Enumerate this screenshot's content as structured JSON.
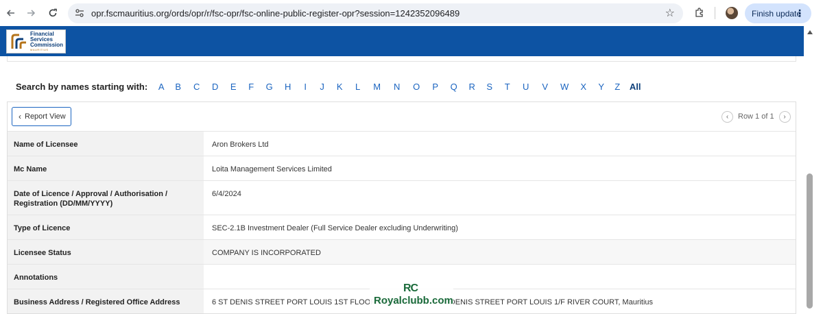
{
  "browser": {
    "url": "opr.fscmauritius.org/ords/opr/r/fsc-opr/fsc-online-public-register-opr?session=1242352096489",
    "finish_update_label": "Finish update"
  },
  "header": {
    "logo_lines": [
      "Financial",
      "Services",
      "Commission"
    ],
    "logo_sub": "MAURITIUS"
  },
  "alpha_filter": {
    "label": "Search by names starting with:",
    "letters": [
      "A",
      "B",
      "C",
      "D",
      "E",
      "F",
      "G",
      "H",
      "I",
      "J",
      "K",
      "L",
      "M",
      "N",
      "O",
      "P",
      "Q",
      "R",
      "S",
      "T",
      "U",
      "V",
      "W",
      "X",
      "Y",
      "Z"
    ],
    "all_label": "All"
  },
  "report": {
    "back_label": "Report View",
    "pager_text": "Row 1 of 1",
    "rows": [
      {
        "label": "Name of Licensee",
        "value": "Aron Brokers Ltd"
      },
      {
        "label": "Mc Name",
        "value": "Loita Management Services Limited"
      },
      {
        "label": "Date of Licence / Approval / Authorisation / Registration (DD/MM/YYYY)",
        "value": "6/4/2024"
      },
      {
        "label": "Type of Licence",
        "value": "SEC-2.1B Investment Dealer (Full Service Dealer excluding Underwriting)"
      },
      {
        "label": "Licensee Status",
        "value": "COMPANY IS INCORPORATED"
      },
      {
        "label": "Annotations",
        "value": ""
      },
      {
        "label": "Business Address / Registered Office Address",
        "value": "6 ST DENIS STREET PORT LOUIS 1ST FLOOR RIVER COURT 6 ST DENIS STREET PORT LOUIS 1/F RIVER COURT, Mauritius"
      }
    ]
  },
  "watermark": {
    "mark": "RC",
    "text": "Royalclubb.com"
  }
}
